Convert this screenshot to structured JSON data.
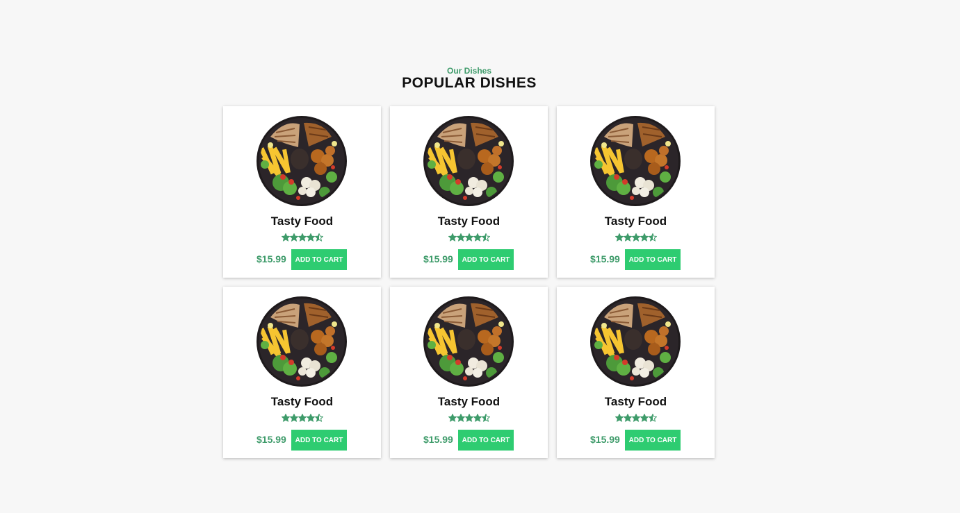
{
  "section": {
    "subtitle": "Our Dishes",
    "title": "POPULAR DISHES"
  },
  "colors": {
    "accent": "#3e9b6a",
    "button": "#2ecc71",
    "background": "#f7f7f7"
  },
  "dishes": [
    {
      "name": "Tasty Food",
      "rating": 4.5,
      "price": "$15.99",
      "button_label": "ADD TO CART",
      "image_icon": "food-plate-image"
    },
    {
      "name": "Tasty Food",
      "rating": 4.5,
      "price": "$15.99",
      "button_label": "ADD TO CART",
      "image_icon": "food-plate-image"
    },
    {
      "name": "Tasty Food",
      "rating": 4.5,
      "price": "$15.99",
      "button_label": "ADD TO CART",
      "image_icon": "food-plate-image"
    },
    {
      "name": "Tasty Food",
      "rating": 4.5,
      "price": "$15.99",
      "button_label": "ADD TO CART",
      "image_icon": "food-plate-image"
    },
    {
      "name": "Tasty Food",
      "rating": 4.5,
      "price": "$15.99",
      "button_label": "ADD TO CART",
      "image_icon": "food-plate-image"
    },
    {
      "name": "Tasty Food",
      "rating": 4.5,
      "price": "$15.99",
      "button_label": "ADD TO CART",
      "image_icon": "food-plate-image"
    }
  ]
}
